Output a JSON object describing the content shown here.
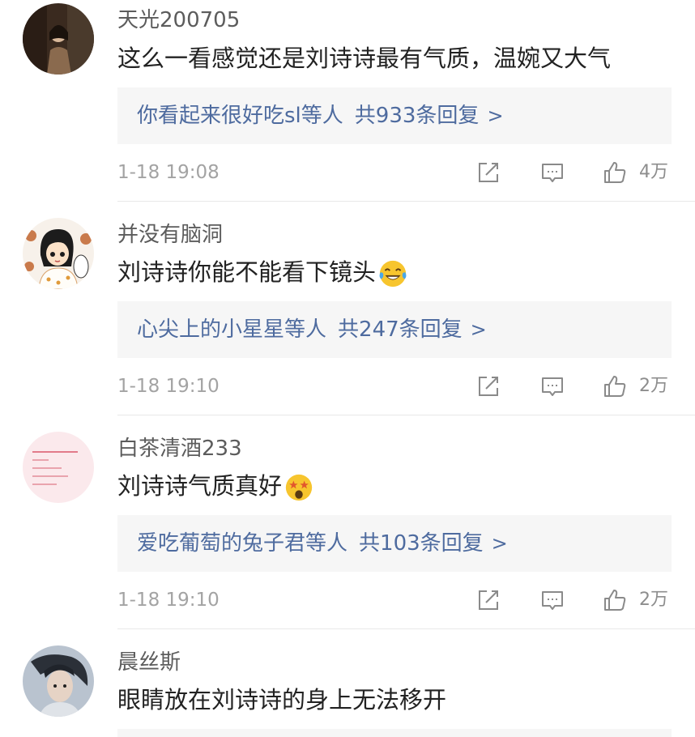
{
  "comments": [
    {
      "username": "天光200705",
      "text": "这么一看感觉还是刘诗诗最有气质，温婉又大气",
      "emoji": "",
      "replies": {
        "who": "你看起来很好吃sl",
        "suffix": "等人",
        "count": "共933条回复",
        "chevron": ">"
      },
      "timestamp": "1-18 19:08",
      "likes": "4万"
    },
    {
      "username": "并没有脑洞",
      "text": "刘诗诗你能不能看下镜头",
      "emoji": "laughing-tears-emoji",
      "replies": {
        "who": "心尖上的小星星",
        "suffix": "等人",
        "count": "共247条回复",
        "chevron": ">"
      },
      "timestamp": "1-18 19:10",
      "likes": "2万"
    },
    {
      "username": "白茶清酒233",
      "text": "刘诗诗气质真好",
      "emoji": "starstruck-emoji",
      "replies": {
        "who": "爱吃葡萄的兔子君",
        "suffix": "等人",
        "count": "共103条回复",
        "chevron": ">"
      },
      "timestamp": "1-18 19:10",
      "likes": "2万"
    },
    {
      "username": "晨丝斯",
      "text": "眼睛放在刘诗诗的身上无法移开",
      "emoji": ""
    }
  ],
  "icons": {
    "share": "share-edit-icon",
    "comment": "comment-bubble-icon",
    "like": "thumbs-up-icon"
  },
  "colors": {
    "link": "#4e6b9f",
    "reply_bg": "#f6f6f6",
    "meta": "#a3a3a3",
    "icon": "#8a8a8a"
  }
}
